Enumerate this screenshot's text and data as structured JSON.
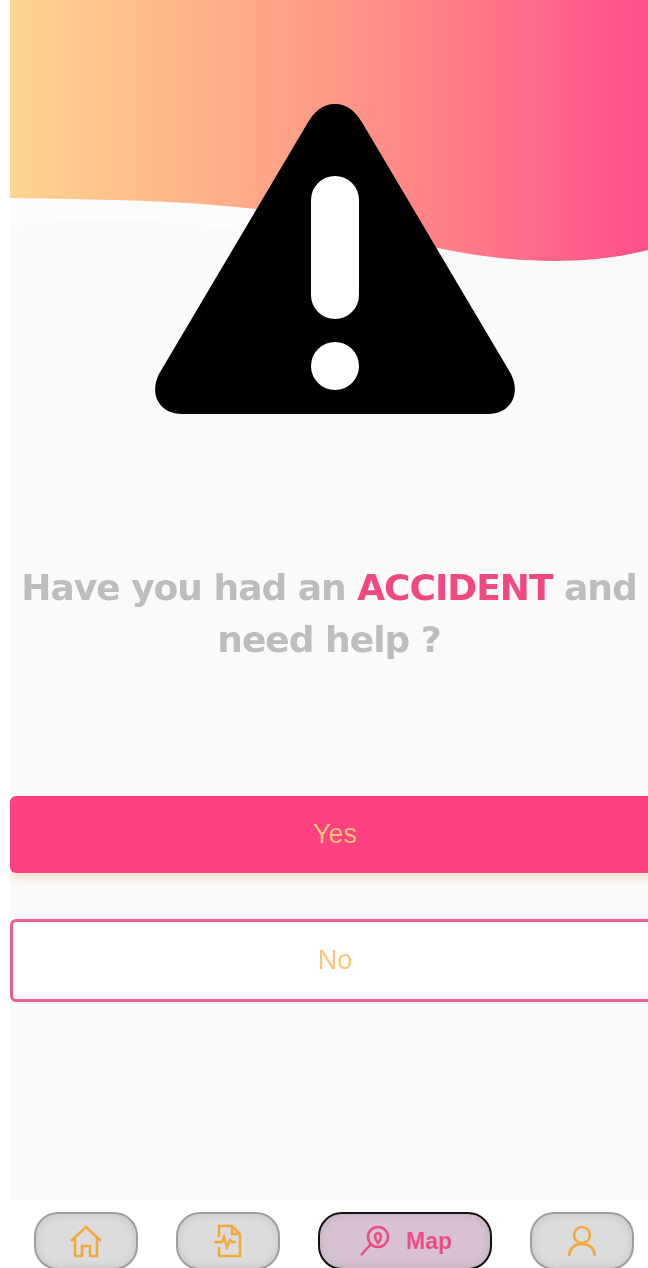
{
  "prompt": {
    "text": "Have you had an **ACCIDENT** and need help ?"
  },
  "buttons": [
    {
      "kind": "primary",
      "label": "Yes"
    },
    {
      "kind": "outline",
      "label": "No"
    }
  ],
  "nav": [
    {
      "kind": "home",
      "selected": false
    },
    {
      "kind": "report",
      "selected": false
    },
    {
      "kind": "map",
      "selected": true,
      "label": "Map"
    },
    {
      "kind": "profile",
      "selected": false
    }
  ]
}
